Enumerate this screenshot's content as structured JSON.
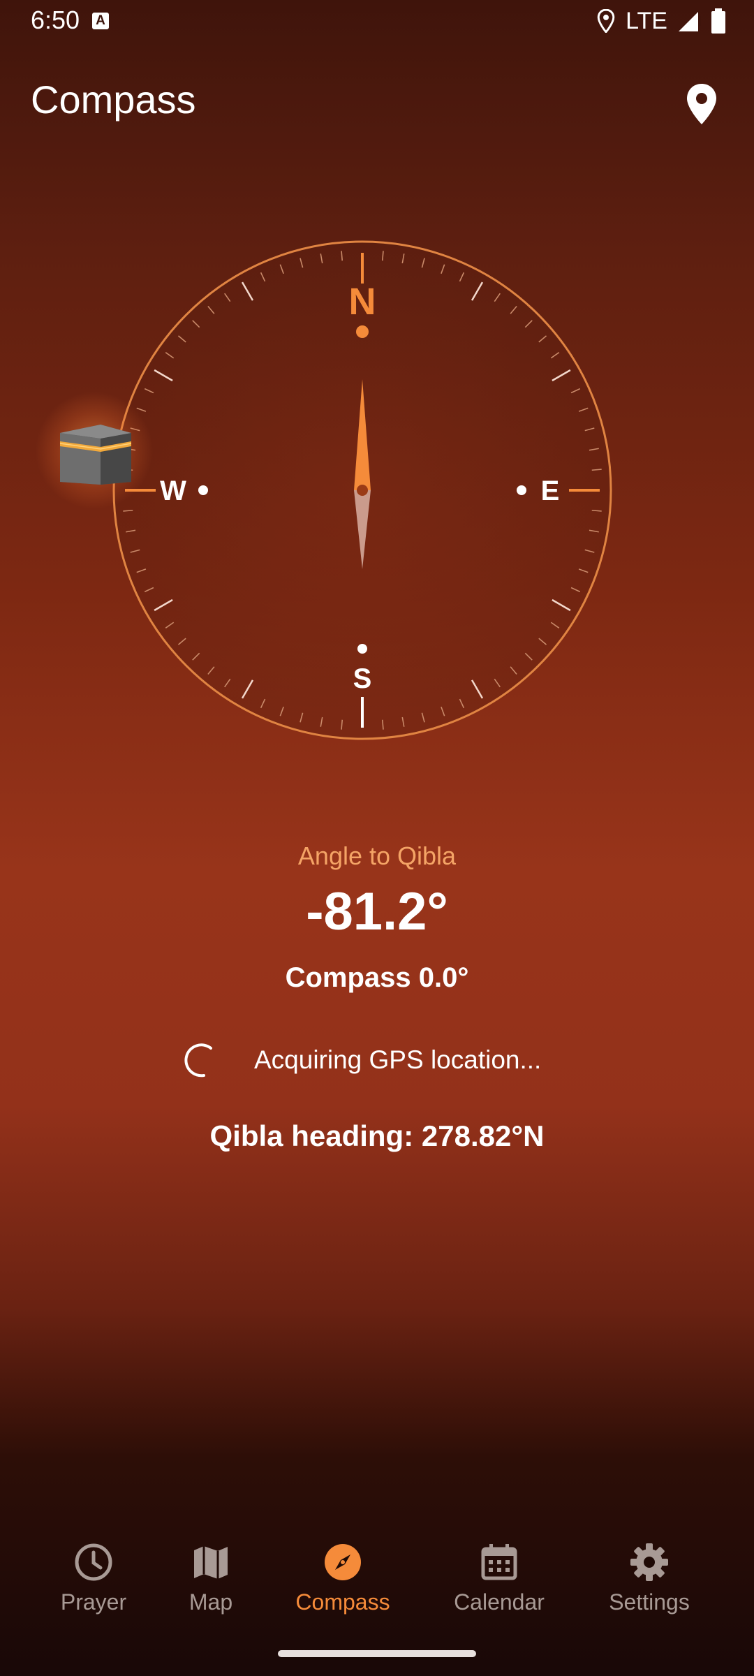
{
  "status_bar": {
    "time": "6:50",
    "notification_icon_letter": "A",
    "network": "LTE"
  },
  "app_bar": {
    "title": "Compass",
    "action_icon": "location-pin-icon"
  },
  "compass": {
    "cardinals": {
      "north": "N",
      "east": "E",
      "south": "S",
      "west": "W"
    },
    "heading_deg": 0.0,
    "qibla_marker_icon": "kaaba-icon",
    "accent_color": "#f58b3a"
  },
  "qibla_info": {
    "angle_label": "Angle to Qibla",
    "angle_value": "-81.2°",
    "compass_reading": "Compass 0.0°",
    "gps_status": "Acquiring GPS location...",
    "heading": "Qibla heading: 278.82°N"
  },
  "bottom_nav": {
    "active": "Compass",
    "items": [
      {
        "label": "Prayer",
        "icon": "clock-icon"
      },
      {
        "label": "Map",
        "icon": "map-icon"
      },
      {
        "label": "Compass",
        "icon": "compass-icon"
      },
      {
        "label": "Calendar",
        "icon": "calendar-icon"
      },
      {
        "label": "Settings",
        "icon": "gear-icon"
      }
    ]
  },
  "colors": {
    "accent": "#f58b3a",
    "label_orange": "#f4a466",
    "nav_inactive": "#a89a95"
  }
}
